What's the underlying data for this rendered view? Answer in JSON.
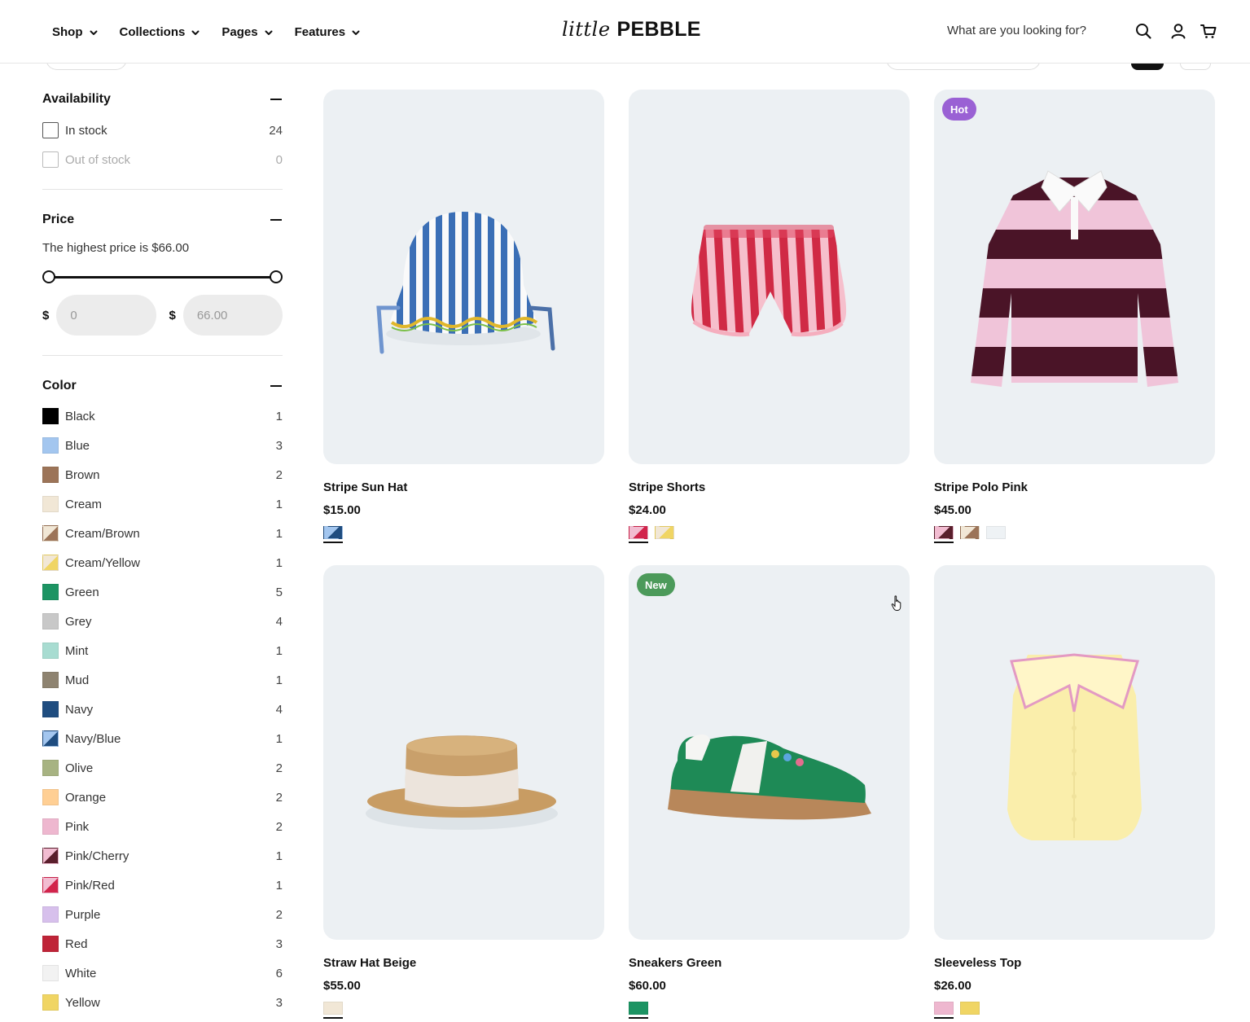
{
  "header": {
    "nav": [
      {
        "label": "Shop"
      },
      {
        "label": "Collections"
      },
      {
        "label": "Pages"
      },
      {
        "label": "Features"
      }
    ],
    "logo_script": "little",
    "logo_bold": "PEBBLE",
    "search_placeholder": "What are you looking for?",
    "icons": [
      "search-icon",
      "account-icon",
      "cart-icon"
    ]
  },
  "filters": {
    "availability": {
      "title": "Availability",
      "options": [
        {
          "label": "In stock",
          "count": "24"
        },
        {
          "label": "Out of stock",
          "count": "0"
        }
      ]
    },
    "price": {
      "title": "Price",
      "note": "The highest price is $66.00",
      "currency": "$",
      "min_placeholder": "0",
      "max_placeholder": "66.00",
      "range_fraction": [
        0,
        1
      ]
    },
    "color": {
      "title": "Color",
      "options": [
        {
          "label": "Black",
          "count": "1",
          "colors": [
            "#000000"
          ]
        },
        {
          "label": "Blue",
          "count": "3",
          "colors": [
            "#a3c6ef"
          ]
        },
        {
          "label": "Brown",
          "count": "2",
          "colors": [
            "#9c7458"
          ]
        },
        {
          "label": "Cream",
          "count": "1",
          "colors": [
            "#f1e7d6"
          ]
        },
        {
          "label": "Cream/Brown",
          "count": "1",
          "colors": [
            "#f1e7d6",
            "#9c7458"
          ]
        },
        {
          "label": "Cream/Yellow",
          "count": "1",
          "colors": [
            "#f1e7d6",
            "#f0d564"
          ]
        },
        {
          "label": "Green",
          "count": "5",
          "colors": [
            "#1c9463"
          ]
        },
        {
          "label": "Grey",
          "count": "4",
          "colors": [
            "#c8c8c8"
          ]
        },
        {
          "label": "Mint",
          "count": "1",
          "colors": [
            "#a8dcd1"
          ]
        },
        {
          "label": "Mud",
          "count": "1",
          "colors": [
            "#8e8370"
          ]
        },
        {
          "label": "Navy",
          "count": "4",
          "colors": [
            "#1f4d80"
          ]
        },
        {
          "label": "Navy/Blue",
          "count": "1",
          "colors": [
            "#a3c6ef",
            "#1f4d80"
          ]
        },
        {
          "label": "Olive",
          "count": "2",
          "colors": [
            "#a7b382"
          ]
        },
        {
          "label": "Orange",
          "count": "2",
          "colors": [
            "#ffcf94"
          ]
        },
        {
          "label": "Pink",
          "count": "2",
          "colors": [
            "#eeb7cf"
          ]
        },
        {
          "label": "Pink/Cherry",
          "count": "1",
          "colors": [
            "#f2bcd1",
            "#5a1f2c"
          ]
        },
        {
          "label": "Pink/Red",
          "count": "1",
          "colors": [
            "#f2bcd1",
            "#d2244b"
          ]
        },
        {
          "label": "Purple",
          "count": "2",
          "colors": [
            "#d7c0ec"
          ]
        },
        {
          "label": "Red",
          "count": "3",
          "colors": [
            "#bf2438"
          ]
        },
        {
          "label": "White",
          "count": "6",
          "colors": [
            "#f2f2f2"
          ]
        },
        {
          "label": "Yellow",
          "count": "3",
          "colors": [
            "#f0d564"
          ]
        }
      ]
    }
  },
  "products": [
    {
      "name": "Stripe Sun Hat",
      "price": "$15.00",
      "badge": "",
      "image": "bucket-hat",
      "swatches": [
        [
          "#a3c6ef",
          "#1f4d80"
        ]
      ]
    },
    {
      "name": "Stripe Shorts",
      "price": "$24.00",
      "badge": "",
      "image": "shorts",
      "swatches": [
        [
          "#f2bcd1",
          "#d2244b"
        ],
        [
          "#f1e7d6",
          "#f0d564"
        ]
      ]
    },
    {
      "name": "Stripe Polo Pink",
      "price": "$45.00",
      "badge": "Hot",
      "badge_color": "#9a61d4",
      "image": "polo",
      "swatches": [
        [
          "#f2bcd1",
          "#5a1f2c"
        ],
        [
          "#f1e7d6",
          "#9c7458"
        ],
        [
          "#eef2f5"
        ]
      ]
    },
    {
      "name": "Straw Hat Beige",
      "price": "$55.00",
      "badge": "",
      "image": "straw-hat",
      "swatches": [
        [
          "#f1e7d6"
        ]
      ]
    },
    {
      "name": "Sneakers Green",
      "price": "$60.00",
      "badge": "New",
      "badge_color": "#4c9a5a",
      "image": "sneaker",
      "swatches": [
        [
          "#1c9463"
        ]
      ]
    },
    {
      "name": "Sleeveless Top",
      "price": "$26.00",
      "badge": "",
      "image": "top",
      "swatches": [
        [
          "#eeb7cf"
        ],
        [
          "#f0d564"
        ]
      ]
    }
  ]
}
